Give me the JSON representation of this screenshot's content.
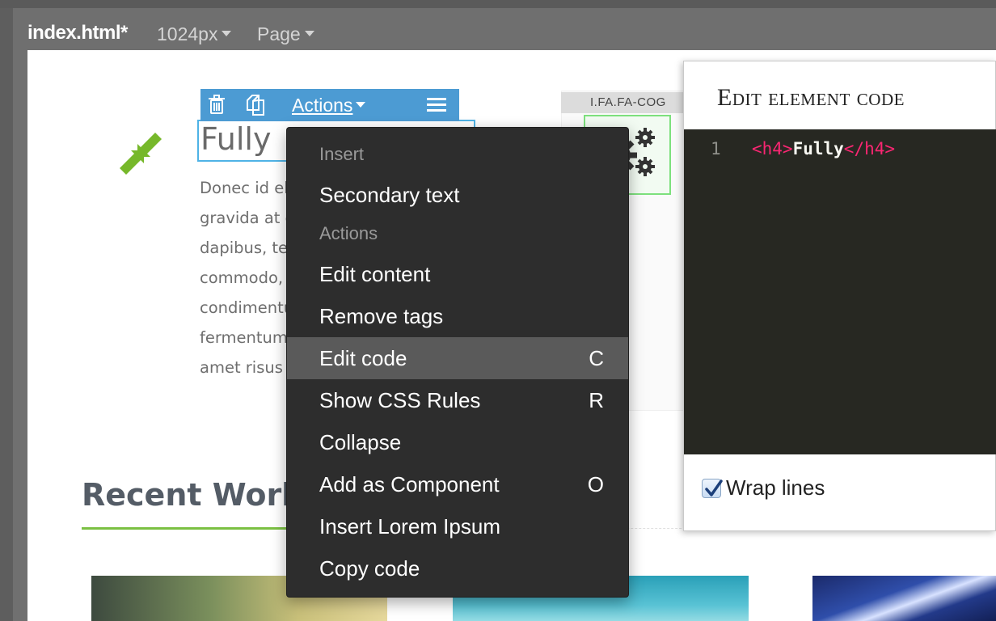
{
  "topbar": {
    "file_name": "index.html*",
    "width_dropdown": "1024px",
    "page_dropdown": "Page"
  },
  "element_toolbar": {
    "actions_label": "Actions"
  },
  "content": {
    "heading": "Fully",
    "paragraph_lines": [
      "Donec id elit non mi porta",
      "gravida at eget metus. Fusce",
      "dapibus, tellus ac cursus",
      "commodo, tortor mauris",
      "condimentum nibh, ut",
      "fermentum massa justo sit",
      "amet risus etiam porta."
    ],
    "cog_selector_label": "I.FA.FA-COG",
    "section_title": "Recent Works"
  },
  "context_menu": {
    "header_insert": "Insert",
    "secondary_text": "Secondary text",
    "header_actions": "Actions",
    "items": [
      {
        "label": "Edit content",
        "shortcut": ""
      },
      {
        "label": "Remove tags",
        "shortcut": ""
      },
      {
        "label": "Edit code",
        "shortcut": "C"
      },
      {
        "label": "Show CSS Rules",
        "shortcut": "R"
      },
      {
        "label": "Collapse",
        "shortcut": ""
      },
      {
        "label": "Add as Component",
        "shortcut": "O"
      },
      {
        "label": "Insert Lorem Ipsum",
        "shortcut": ""
      },
      {
        "label": "Copy code",
        "shortcut": ""
      }
    ]
  },
  "code_panel": {
    "title": "Edit element code",
    "line_number": "1",
    "code_open_tag": "<h4>",
    "code_text": "Fully",
    "code_close_tag": "</h4>",
    "wrap_lines_label": "Wrap lines",
    "wrap_lines_checked": true
  },
  "colors": {
    "toolbar_blue": "#4c9bd3",
    "accent_green": "#7bc043",
    "menu_bg": "#2d2d2d",
    "menu_active": "#5a5a5a",
    "editor_bg": "#272822",
    "tag_pink": "#f92672"
  }
}
